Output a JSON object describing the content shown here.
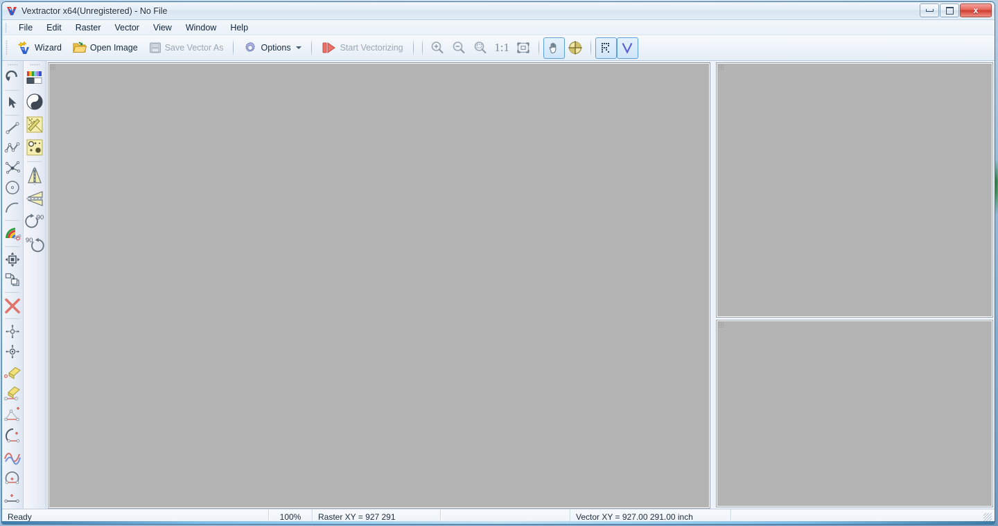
{
  "window": {
    "title": "Vextractor x64(Unregistered) - No File",
    "app_icon": "vextractor-logo-icon",
    "buttons": {
      "minimize": "minimize-icon",
      "maximize": "maximize-icon",
      "close": "x"
    }
  },
  "menubar": {
    "items": [
      {
        "label": "File"
      },
      {
        "label": "Edit"
      },
      {
        "label": "Raster"
      },
      {
        "label": "Vector"
      },
      {
        "label": "View"
      },
      {
        "label": "Window"
      },
      {
        "label": "Help"
      }
    ]
  },
  "toolbar": {
    "wizard_label": "Wizard",
    "open_image_label": "Open Image",
    "save_vector_as_label": "Save Vector As",
    "options_label": "Options",
    "start_vectorizing_label": "Start Vectorizing",
    "zoom_in": "zoom-in-icon",
    "zoom_out": "zoom-out-icon",
    "zoom_area": "zoom-area-icon",
    "zoom_actual": "1:1",
    "zoom_fit": "zoom-fit-icon",
    "pan": "pan-hand-icon",
    "center": "center-target-icon",
    "raster_layer": "raster-toggle-icon",
    "vector_layer": "vector-toggle-icon"
  },
  "left_tools": {
    "items": [
      {
        "name": "undo-tool",
        "label": "Undo"
      },
      {
        "name": "select-arrow-tool",
        "label": "Select"
      },
      {
        "name": "line-tool",
        "label": "Line"
      },
      {
        "name": "polyline-tool",
        "label": "Polyline"
      },
      {
        "name": "node-edit-tool",
        "label": "Edit Nodes"
      },
      {
        "name": "circle-tool",
        "label": "Circle"
      },
      {
        "name": "arc-tool",
        "label": "Arc"
      },
      {
        "name": "color-layers-tool",
        "label": "Color Layers"
      },
      {
        "name": "move-object-tool",
        "label": "Move Object"
      },
      {
        "name": "copy-object-tool",
        "label": "Copy Object"
      },
      {
        "name": "delete-object-tool",
        "label": "Delete Object"
      },
      {
        "name": "move-node-tool",
        "label": "Move Node"
      },
      {
        "name": "move-node-precise-tool",
        "label": "Move Node Precisely"
      },
      {
        "name": "erase-point-tool",
        "label": "Erase Point"
      },
      {
        "name": "erase-segment-tool",
        "label": "Erase Segment"
      },
      {
        "name": "add-node-tool",
        "label": "Add Node"
      },
      {
        "name": "arc-node-tool",
        "label": "Arc Node"
      },
      {
        "name": "smooth-curve-tool",
        "label": "Smooth Curve"
      },
      {
        "name": "close-contour-tool",
        "label": "Close Contour"
      },
      {
        "name": "join-points-tool",
        "label": "Join Points"
      }
    ]
  },
  "raster_tools": {
    "items": [
      {
        "name": "color-palette-tool",
        "label": "Palette"
      },
      {
        "name": "brightness-contrast-tool",
        "label": "Brightness / Contrast"
      },
      {
        "name": "magic-wand-tool",
        "label": "Magic Wand"
      },
      {
        "name": "noise-filter-tool",
        "label": "Noise Filter"
      },
      {
        "name": "flip-vertical-tool",
        "label": "Flip Vertical"
      },
      {
        "name": "flip-horizontal-tool",
        "label": "Flip Horizontal"
      },
      {
        "name": "rotate-cw-90-tool",
        "label": "Rotate 90 CW"
      },
      {
        "name": "rotate-ccw-90-tool",
        "label": "Rotate 90 CCW"
      }
    ],
    "rotate_cw_label": "90",
    "rotate_ccw_label": "90"
  },
  "statusbar": {
    "message": "Ready",
    "zoom": "100%",
    "raster_xy": "Raster XY =  927  291",
    "spacer": "",
    "vector_xy": "Vector XY = 927.00 291.00 inch"
  },
  "colors": {
    "accent": "#5ba0dc",
    "titlebar": "#e4eef8",
    "canvas": "#b4b4b4",
    "chrome": "#eef3f9",
    "close_button": "#cf3d30"
  }
}
